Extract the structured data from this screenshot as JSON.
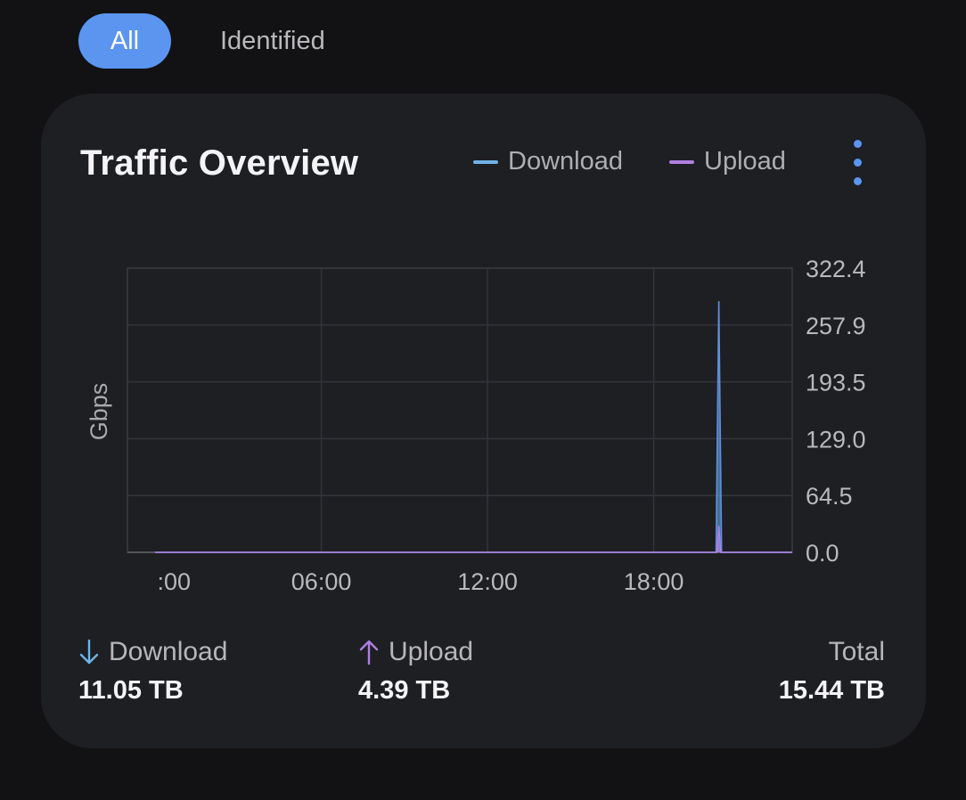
{
  "tabs": [
    {
      "label": "All",
      "active": true
    },
    {
      "label": "Identified",
      "active": false
    }
  ],
  "card": {
    "title": "Traffic Overview",
    "menu_icon": "more-vertical-icon"
  },
  "colors": {
    "accent": "#5b95f0",
    "download": "#6fb3e6",
    "upload": "#b07fe0",
    "background": "#121214",
    "card": "#1e1f23"
  },
  "chart_data": {
    "type": "area",
    "ylabel": "Gbps",
    "yticks": [
      "322.4",
      "257.9",
      "193.5",
      "129.0",
      "64.5",
      "0.0"
    ],
    "ylim": [
      0,
      322.4
    ],
    "xticks": [
      ":00",
      "06:00",
      "12:00",
      "18:00"
    ],
    "xlim": [
      -1,
      23
    ],
    "series": [
      {
        "name": "Download",
        "color": "#6fb3e6",
        "points": [
          [
            0,
            0
          ],
          [
            20.25,
            0
          ],
          [
            20.35,
            285
          ],
          [
            20.45,
            0
          ],
          [
            23,
            0
          ]
        ]
      },
      {
        "name": "Upload",
        "color": "#b07fe0",
        "points": [
          [
            0,
            0
          ],
          [
            20.28,
            0
          ],
          [
            20.35,
            30
          ],
          [
            20.42,
            0
          ],
          [
            23,
            0
          ]
        ]
      }
    ],
    "grid": true,
    "legend": "top-right"
  },
  "stats": {
    "download": {
      "label": "Download",
      "value": "11.05 TB",
      "icon": "arrow-down-icon"
    },
    "upload": {
      "label": "Upload",
      "value": "4.39 TB",
      "icon": "arrow-up-icon"
    },
    "total": {
      "label": "Total",
      "value": "15.44 TB"
    }
  }
}
